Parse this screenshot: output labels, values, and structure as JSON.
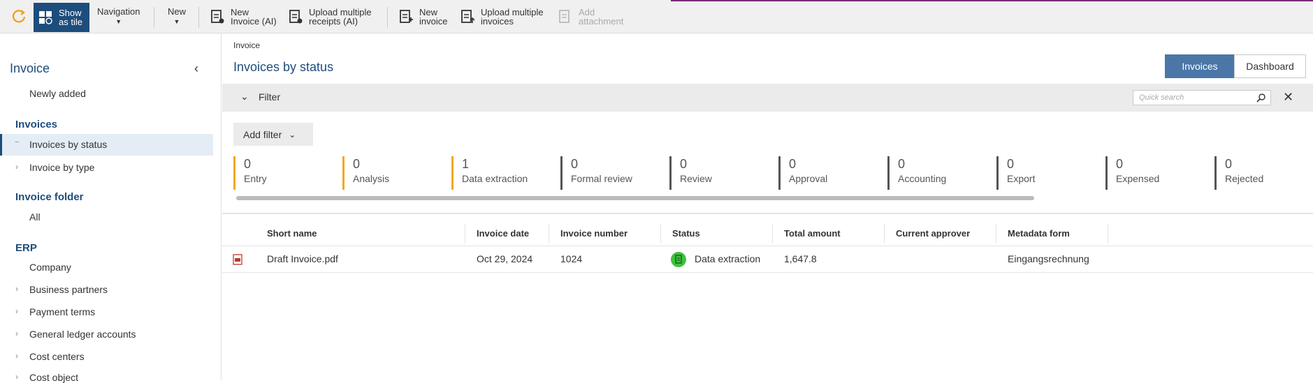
{
  "toolbar": {
    "show_tile": [
      "Show",
      "as tile"
    ],
    "navigation": "Navigation",
    "new": "New",
    "new_invoice_ai": [
      "New",
      "Invoice (AI)"
    ],
    "upload_receipts_ai": [
      "Upload multiple",
      "receipts (AI)"
    ],
    "new_invoice": [
      "New",
      "invoice"
    ],
    "upload_invoices": [
      "Upload multiple",
      "invoices"
    ],
    "add_attachment": [
      "Add",
      "attachment"
    ],
    "accent_color": "#1d4d7c"
  },
  "sidebar": {
    "title": "Invoice",
    "newly_added": "Newly added",
    "invoices_head": "Invoices",
    "invoices_by_status": "Invoices by status",
    "invoice_by_type": "Invoice by type",
    "folder_head": "Invoice folder",
    "all": "All",
    "erp_head": "ERP",
    "company": "Company",
    "business_partners": "Business partners",
    "payment_terms": "Payment terms",
    "gl_accounts": "General ledger accounts",
    "cost_centers": "Cost centers",
    "cost_object": "Cost object"
  },
  "main": {
    "breadcrumb": "Invoice",
    "title": "Invoices by status",
    "tab_invoices": "Invoices",
    "tab_dashboard": "Dashboard",
    "filter_label": "Filter",
    "quick_search_placeholder": "Quick search",
    "add_filter": "Add filter"
  },
  "status_tiles": [
    {
      "count": "0",
      "name": "Entry",
      "color": "#f5a623"
    },
    {
      "count": "0",
      "name": "Analysis",
      "color": "#f5a623"
    },
    {
      "count": "1",
      "name": "Data extraction",
      "color": "#f5a623"
    },
    {
      "count": "0",
      "name": "Formal review",
      "color": "#555555"
    },
    {
      "count": "0",
      "name": "Review",
      "color": "#555555"
    },
    {
      "count": "0",
      "name": "Approval",
      "color": "#555555"
    },
    {
      "count": "0",
      "name": "Accounting",
      "color": "#555555"
    },
    {
      "count": "0",
      "name": "Export",
      "color": "#555555"
    },
    {
      "count": "0",
      "name": "Expensed",
      "color": "#555555"
    },
    {
      "count": "0",
      "name": "Rejected",
      "color": "#555555"
    }
  ],
  "table": {
    "columns": [
      "Short name",
      "Invoice date",
      "Invoice number",
      "Status",
      "Total amount",
      "Current approver",
      "Metadata form"
    ],
    "rows": [
      {
        "short_name": "Draft Invoice.pdf",
        "invoice_date": "Oct 29, 2024",
        "invoice_number": "1024",
        "status": "Data extraction",
        "total_amount": "1,647.8",
        "current_approver": "",
        "metadata_form": "Eingangsrechnung"
      }
    ]
  }
}
